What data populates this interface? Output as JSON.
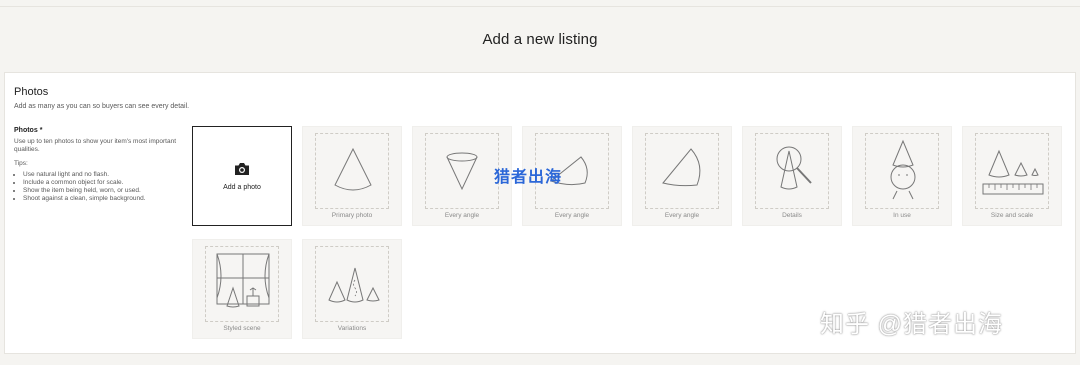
{
  "header": {
    "title": "Add a new listing"
  },
  "photos": {
    "title": "Photos",
    "subtitle": "Add as many as you can so buyers can see every detail.",
    "label": "Photos",
    "required_mark": "*",
    "description": "Use up to ten photos to show your item's most important qualities.",
    "tips_heading": "Tips:",
    "tips": [
      "Use natural light and no flash.",
      "Include a common object for scale.",
      "Show the item being held, worn, or used.",
      "Shoot against a clean, simple background."
    ],
    "add_label": "Add a photo",
    "slots": [
      {
        "caption": "Primary photo",
        "icon": "cone-icon"
      },
      {
        "caption": "Every angle",
        "icon": "inverted-cone-icon"
      },
      {
        "caption": "Every angle",
        "icon": "cone-side-icon"
      },
      {
        "caption": "Every angle",
        "icon": "tilted-cone-icon"
      },
      {
        "caption": "Details",
        "icon": "magnifier-cone-icon"
      },
      {
        "caption": "In use",
        "icon": "cone-hat-face-icon"
      },
      {
        "caption": "Size and scale",
        "icon": "cones-ruler-icon"
      },
      {
        "caption": "Styled scene",
        "icon": "window-scene-icon"
      },
      {
        "caption": "Variations",
        "icon": "cone-variations-icon"
      }
    ]
  },
  "watermarks": {
    "center": "猎者出海",
    "bottom_right": "知乎 @猎者出海"
  }
}
